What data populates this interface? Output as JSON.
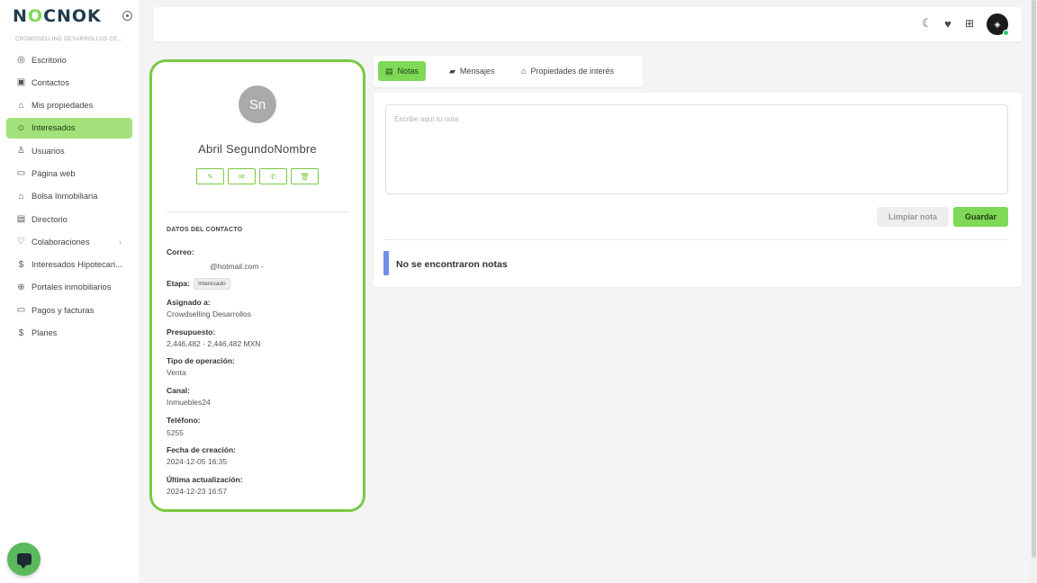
{
  "brand": {
    "logo_left": "N",
    "logo_o": "O",
    "logo_right": "CNOK",
    "company": "CROWDSELLING DESARROLLOS CE..."
  },
  "sidebar": {
    "items": [
      {
        "label": "Escritorio",
        "icon": "dashboard-icon",
        "glyph": "◎"
      },
      {
        "label": "Contactos",
        "icon": "contacts-icon",
        "glyph": "▣"
      },
      {
        "label": "Mis propiedades",
        "icon": "home-icon",
        "glyph": "⌂"
      },
      {
        "label": "Interesados",
        "icon": "smiley-icon",
        "glyph": "☺"
      },
      {
        "label": "Usuarios",
        "icon": "user-icon",
        "glyph": "♙"
      },
      {
        "label": "Página web",
        "icon": "browser-icon",
        "glyph": "▭"
      },
      {
        "label": "Bolsa Inmobiliaria",
        "icon": "building-icon",
        "glyph": "⌂"
      },
      {
        "label": "Directorio",
        "icon": "directory-icon",
        "glyph": "▤"
      },
      {
        "label": "Colaboraciones",
        "icon": "handshake-icon",
        "glyph": "♡"
      },
      {
        "label": "Interesados Hipotecari...",
        "icon": "dollar-circle-icon",
        "glyph": "$"
      },
      {
        "label": "Portales inmobiliarios",
        "icon": "globe-icon",
        "glyph": "⊕"
      },
      {
        "label": "Pagos y facturas",
        "icon": "card-icon",
        "glyph": "▭"
      },
      {
        "label": "Planes",
        "icon": "dollar-icon",
        "glyph": "$"
      }
    ],
    "active_index": 3
  },
  "topbar": {
    "icons": [
      "moon-icon",
      "heart-icon",
      "apps-icon"
    ],
    "avatar_label": "user avatar"
  },
  "contact": {
    "initials": "Sn",
    "name": "Abril SegundoNombre",
    "actions": [
      "edit-icon",
      "mail-icon",
      "whatsapp-icon",
      "trash-icon"
    ],
    "section_title": "DATOS DEL CONTACTO",
    "email_label": "Correo:",
    "email_value": "@hotmail.com -",
    "stage_label": "Etapa:",
    "stage_value": "Interesado",
    "assigned_label": "Asignado a:",
    "assigned_value": "Crowdselling Desarrollos",
    "budget_label": "Presupuesto:",
    "budget_value": "2,446,482 - 2,446,482 MXN",
    "operation_label": "Tipo de operación:",
    "operation_value": "Venta",
    "channel_label": "Canal:",
    "channel_value": "Inmuebles24",
    "phone_label": "Teléfono:",
    "phone_value": "5255",
    "created_label": "Fecha de creación:",
    "created_value": "2024-12-05 16:35",
    "updated_label": "Última actualización:",
    "updated_value": "2024-12-23 16:57"
  },
  "tabs": [
    {
      "label": "Notas",
      "icon": "note-icon"
    },
    {
      "label": "Mensajes",
      "icon": "chat-icon"
    },
    {
      "label": "Propiedades de interés",
      "icon": "home-icon"
    }
  ],
  "notes": {
    "placeholder": "Escribe aquí tu nota",
    "clear_label": "Limpiar nota",
    "save_label": "Guardar",
    "empty_text": "No se encontraron notas"
  },
  "colors": {
    "accent": "#7ed957",
    "card_border": "#7ac943",
    "info_bar": "#6f8fe8"
  }
}
